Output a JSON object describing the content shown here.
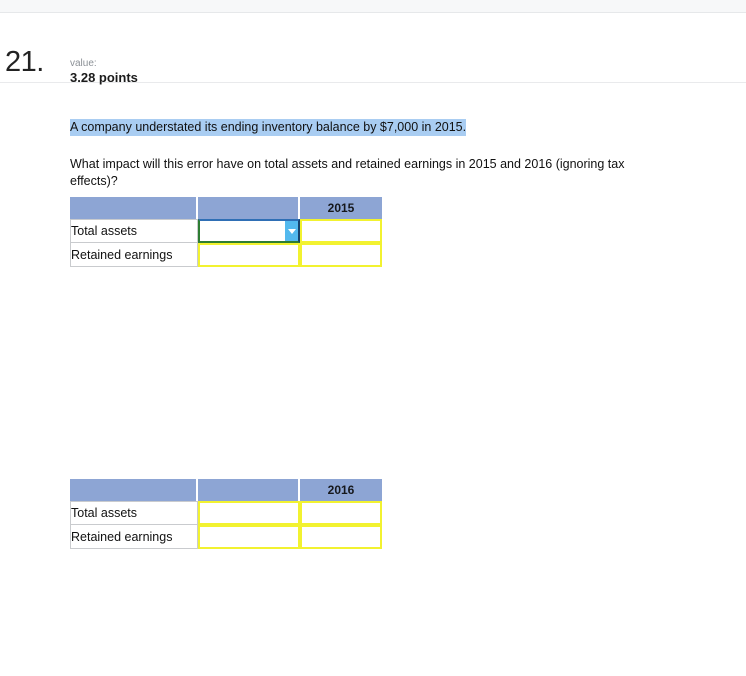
{
  "topbar": {
    "present": true
  },
  "question": {
    "number": "21.",
    "value_label": "value:",
    "points": "3.28 points",
    "stem": "A company understated its ending inventory balance by $7,000 in 2015.",
    "prompt": "What impact will this error have on total assets and retained earnings in 2015 and 2016 (ignoring tax effects)?"
  },
  "colors": {
    "header_blue": "#8da5d4",
    "highlight_blue": "#a9cdf2",
    "input_yellow": "#f2f230",
    "dropdown_blue": "#53b9ee",
    "active_green": "#2e7d32"
  },
  "tables": [
    {
      "id": "table-2015",
      "year_header": "2015",
      "blank_header": "",
      "corner_header": "",
      "rows": [
        {
          "label": "Total assets",
          "answer_value": "",
          "year_value": "",
          "active": true
        },
        {
          "label": "Retained earnings",
          "answer_value": "",
          "year_value": "",
          "active": false
        }
      ]
    },
    {
      "id": "table-2016",
      "year_header": "2016",
      "blank_header": "",
      "corner_header": "",
      "rows": [
        {
          "label": "Total assets",
          "answer_value": "",
          "year_value": "",
          "active": false
        },
        {
          "label": "Retained earnings",
          "answer_value": "",
          "year_value": "",
          "active": false
        }
      ]
    }
  ],
  "dropdown": {
    "icon": "caret-down-icon",
    "selected_value": "",
    "placeholder": ""
  }
}
